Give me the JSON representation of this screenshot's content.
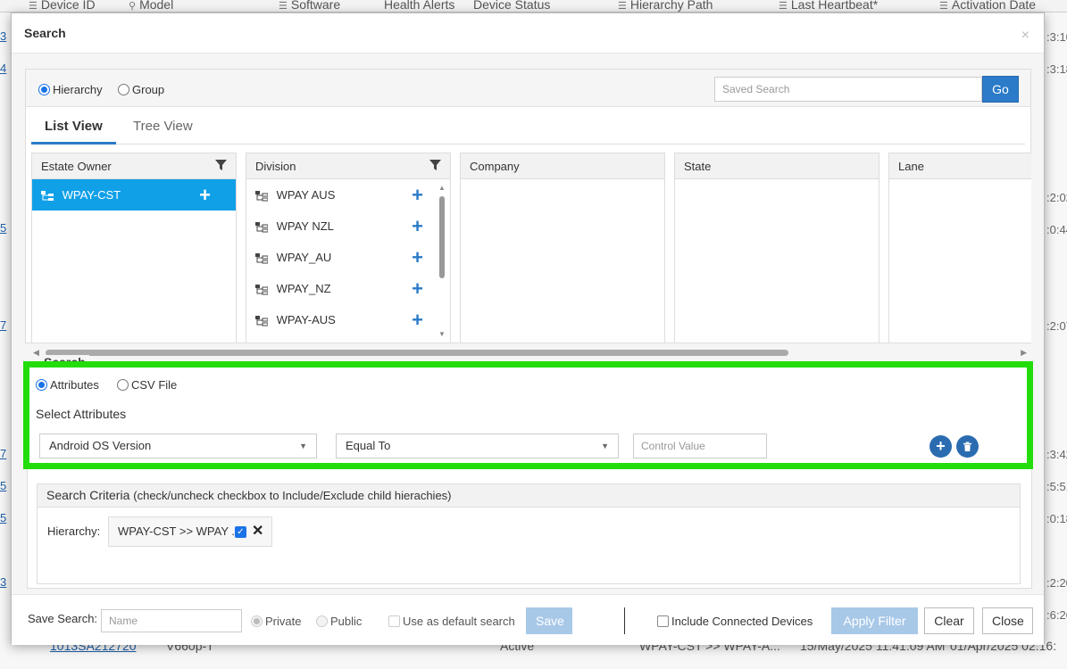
{
  "background": {
    "columns": [
      {
        "label": "Device ID",
        "icon": "list-icon"
      },
      {
        "label": "Model",
        "icon": "filter-icon"
      },
      {
        "label": "Software",
        "icon": "list-icon"
      },
      {
        "label": "Health Alerts"
      },
      {
        "label": "Device Status"
      },
      {
        "label": "Hierarchy Path",
        "icon": "list-icon"
      },
      {
        "label": "Last Heartbeat*",
        "icon": "list-icon"
      },
      {
        "label": "Activation Date",
        "icon": "list-icon"
      }
    ],
    "left_links": [
      "3",
      "4",
      "5",
      "7",
      "7",
      "5",
      "5",
      "3"
    ],
    "right_times": [
      ":3:10",
      ":3:18",
      ":2:02",
      ":0:44",
      ":2:07",
      ":3:42",
      ":5:51",
      ":0:18",
      ":2:20",
      ":6:26",
      ":2:16"
    ],
    "bottom_row": {
      "device_id": "1013SA212720",
      "model": "V660p-T",
      "status": "Active",
      "hierarchy": "WPAY-CST >> WPAY-A...",
      "heartbeat": "15/May/2025 11:41:09 AM",
      "activation": "01/Apr/2025 02:16:"
    }
  },
  "modal": {
    "title": "Search",
    "close": "×",
    "hierarchy_mode": {
      "options": [
        "Hierarchy",
        "Group"
      ],
      "selected": "Hierarchy"
    },
    "saved_search_placeholder": "Saved Search",
    "go_label": "Go",
    "tabs": [
      "List View",
      "Tree View"
    ],
    "active_tab": "List View",
    "columns": [
      {
        "title": "Estate Owner",
        "filter": true,
        "items": [
          "WPAY-CST"
        ],
        "selected": "WPAY-CST"
      },
      {
        "title": "Division",
        "filter": true,
        "items": [
          "WPAY AUS",
          "WPAY NZL",
          "WPAY_AU",
          "WPAY_NZ",
          "WPAY-AUS"
        ]
      },
      {
        "title": "Company",
        "filter": false,
        "items": []
      },
      {
        "title": "State",
        "filter": false,
        "items": []
      },
      {
        "title": "Lane",
        "filter": false,
        "items": []
      }
    ],
    "search": {
      "legend": "Search",
      "mode_options": [
        "Attributes",
        "CSV File"
      ],
      "mode_selected": "Attributes",
      "select_attributes_label": "Select Attributes",
      "attribute": "Android OS Version",
      "operator": "Equal To",
      "control_value_placeholder": "Control Value"
    },
    "criteria": {
      "title": "Search Criteria",
      "subtitle": "(check/uncheck checkbox to Include/Exclude child hierachies)",
      "hierarchy_label": "Hierarchy:",
      "chip_text": "WPAY-CST >> WPAY ..",
      "chip_checked": true
    },
    "footer": {
      "save_search_label": "Save Search:",
      "name_placeholder": "Name",
      "visibility_options": [
        "Private",
        "Public"
      ],
      "visibility_selected": "Private",
      "default_search_label": "Use as default search",
      "save_label": "Save",
      "include_connected_label": "Include Connected Devices",
      "apply_filter_label": "Apply Filter",
      "clear_label": "Clear",
      "close_label": "Close"
    }
  },
  "colors": {
    "accent": "#2b7bc8",
    "selected_item": "#10a0e8",
    "highlight_border": "#22dd0a"
  }
}
